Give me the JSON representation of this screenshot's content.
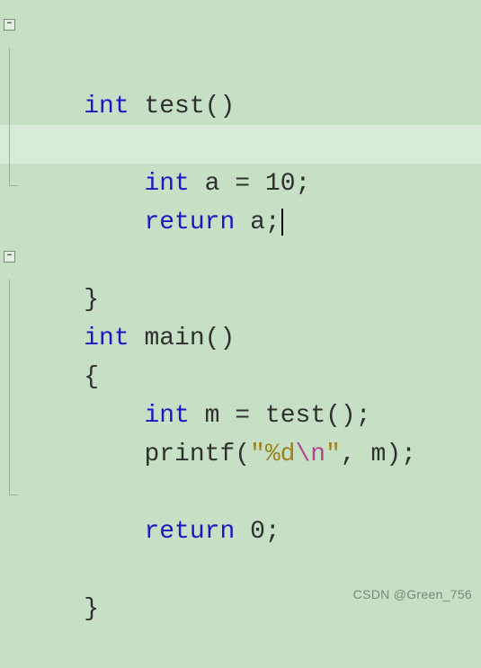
{
  "fold": {
    "collapsed_marker": "-"
  },
  "code": {
    "k_int": "int",
    "k_return": "return",
    "fn_test": "test",
    "fn_main": "main",
    "fn_printf": "printf",
    "var_a": "a",
    "var_m": "m",
    "val_10": "10",
    "val_0": "0",
    "str_open": "\"%d",
    "str_esc": "\\n",
    "str_close": "\"",
    "paren_open": "(",
    "paren_close": ")",
    "paren_close_semi": ");",
    "paren_empty": "()",
    "empty_semi": "();",
    "brace_open": "{",
    "brace_close": "}",
    "eq": " = ",
    "semi": ";",
    "comma_sp": ", "
  },
  "lines_plain": [
    "int test()",
    "{",
    "    int a = 10;",
    "    return a;",
    "}",
    "",
    "int main()",
    "{",
    "    int m = test();",
    "    printf(\"%d\\n\", m);",
    "",
    "    return 0;",
    "}"
  ],
  "watermark": "CSDN @Green_756"
}
